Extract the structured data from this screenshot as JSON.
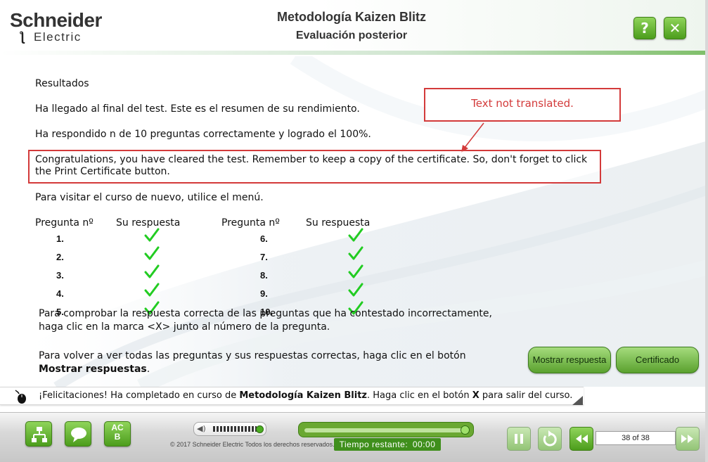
{
  "header": {
    "logo_line1": "Schneider",
    "logo_line2": "Electric",
    "course_title": "Metodología Kaizen Blitz",
    "screen_title": "Evaluación posterior",
    "help_label": "?",
    "close_label": "✕"
  },
  "content": {
    "results_heading": "Resultados",
    "summary_line": "Ha llegado al final del test. Este es el resumen de su rendimiento.",
    "score_line": "Ha respondido n de 10 preguntas correctamente y logrado el  100%.",
    "congrats_text": "Congratulations, you have cleared the test. Remember to keep a copy of the certificate. So, don't forget to click the Print Certificate button.",
    "revisit_line": "Para visitar el curso de nuevo, utilice el menú.",
    "annotation": "Text not translated.",
    "question_header": "Pregunta nº",
    "answer_header": "Su respuesta",
    "questions_left": [
      {
        "num": "1.",
        "correct": true
      },
      {
        "num": "2.",
        "correct": true
      },
      {
        "num": "3.",
        "correct": true
      },
      {
        "num": "4.",
        "correct": true
      },
      {
        "num": "5.",
        "correct": true
      }
    ],
    "questions_right": [
      {
        "num": "6.",
        "correct": true
      },
      {
        "num": "7.",
        "correct": true
      },
      {
        "num": "8.",
        "correct": true
      },
      {
        "num": "9.",
        "correct": true
      },
      {
        "num": "10.",
        "correct": true
      }
    ],
    "instruction1_line1": "Para comprobar la respuesta correcta de las preguntas que ha contestado incorrectamente,",
    "instruction1_line2": "haga clic en la marca <X> junto al número de la pregunta.",
    "instruction2_line1": "Para volver a ver todas las preguntas y sus respuestas correctas, haga clic en el botón",
    "instruction2_bold": "Mostrar respuestas",
    "instruction2_end": ".",
    "show_answers_button": "Mostrar respuesta",
    "certificate_button": "Certificado"
  },
  "feedback": {
    "prefix": "¡Felicitaciones! Ha completado en curso de ",
    "course_bold": "Metodología Kaizen Blitz",
    "middle": ". Haga clic en el botón ",
    "x_bold": "X",
    "suffix": " para salir del curso."
  },
  "footer": {
    "menu_icon": "sitemap-icon",
    "transcript_icon": "speech-bubble-icon",
    "glossary_label_top": "AC",
    "glossary_label_bottom": "B",
    "copyright": "© 2017 Schneider Electric Todos los derechos reservados.",
    "time_label": "Tiempo restante:",
    "time_value": "00:00",
    "page_indicator": "38 of 38",
    "progress_fraction": 1.0
  },
  "colors": {
    "accent_green": "#4c9d1c",
    "annotation_red": "#d33a3a",
    "check_green": "#22cc22"
  }
}
